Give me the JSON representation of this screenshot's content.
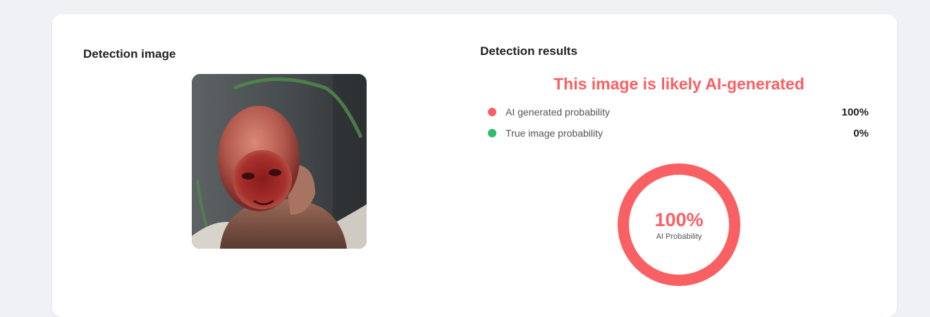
{
  "colors": {
    "ai": "#f96063",
    "real": "#2dbd6e"
  },
  "left": {
    "title": "Detection image"
  },
  "right": {
    "title": "Detection results",
    "verdict": "This image is likely AI-generated",
    "rows": [
      {
        "label": "AI generated probability",
        "value": "100%"
      },
      {
        "label": "True image probability",
        "value": "0%"
      }
    ],
    "gauge": {
      "percent_text": "100%",
      "caption": "AI Probability",
      "fraction": 1.0
    }
  }
}
